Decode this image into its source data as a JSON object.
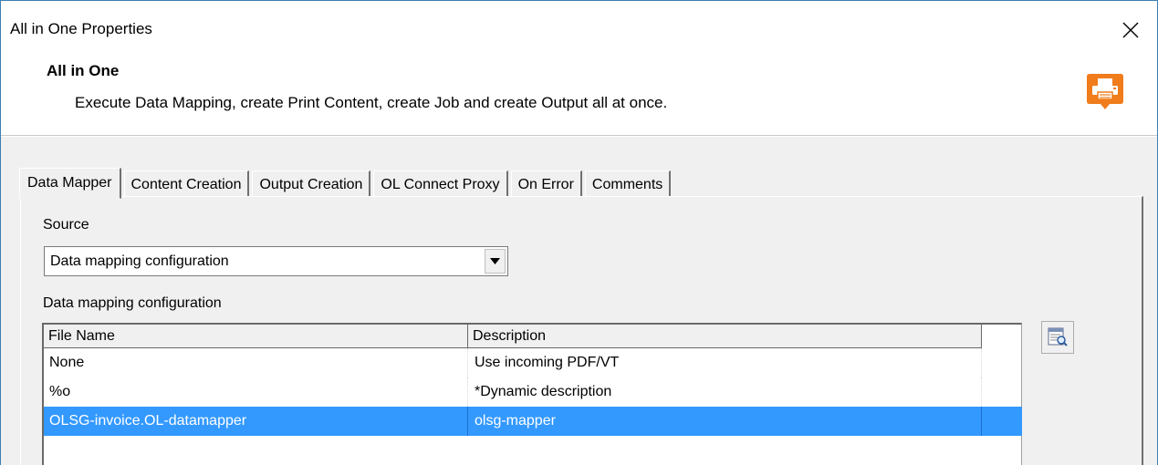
{
  "window": {
    "title": "All in One Properties",
    "close_icon": "close-icon"
  },
  "header": {
    "title": "All in One",
    "description": "Execute Data Mapping, create Print Content, create Job and create Output all at once.",
    "icon": "printer-icon",
    "icon_color": "#f07c1b"
  },
  "tabs": [
    {
      "label": "Data Mapper",
      "active": true
    },
    {
      "label": "Content Creation",
      "active": false
    },
    {
      "label": "Output Creation",
      "active": false
    },
    {
      "label": "OL Connect Proxy",
      "active": false
    },
    {
      "label": "On Error",
      "active": false
    },
    {
      "label": "Comments",
      "active": false
    }
  ],
  "data_mapper": {
    "source_label": "Source",
    "source_value": "Data mapping configuration",
    "config_label": "Data mapping configuration",
    "columns": [
      "File Name",
      "Description"
    ],
    "rows": [
      {
        "file": "None",
        "description": "Use incoming PDF/VT",
        "selected": false
      },
      {
        "file": "%o",
        "description": "*Dynamic description",
        "selected": false
      },
      {
        "file": "OLSG-invoice.OL-datamapper",
        "description": "olsg-mapper",
        "selected": true
      }
    ],
    "browse_icon": "browse-resource-icon",
    "selection_color": "#3399ff"
  }
}
